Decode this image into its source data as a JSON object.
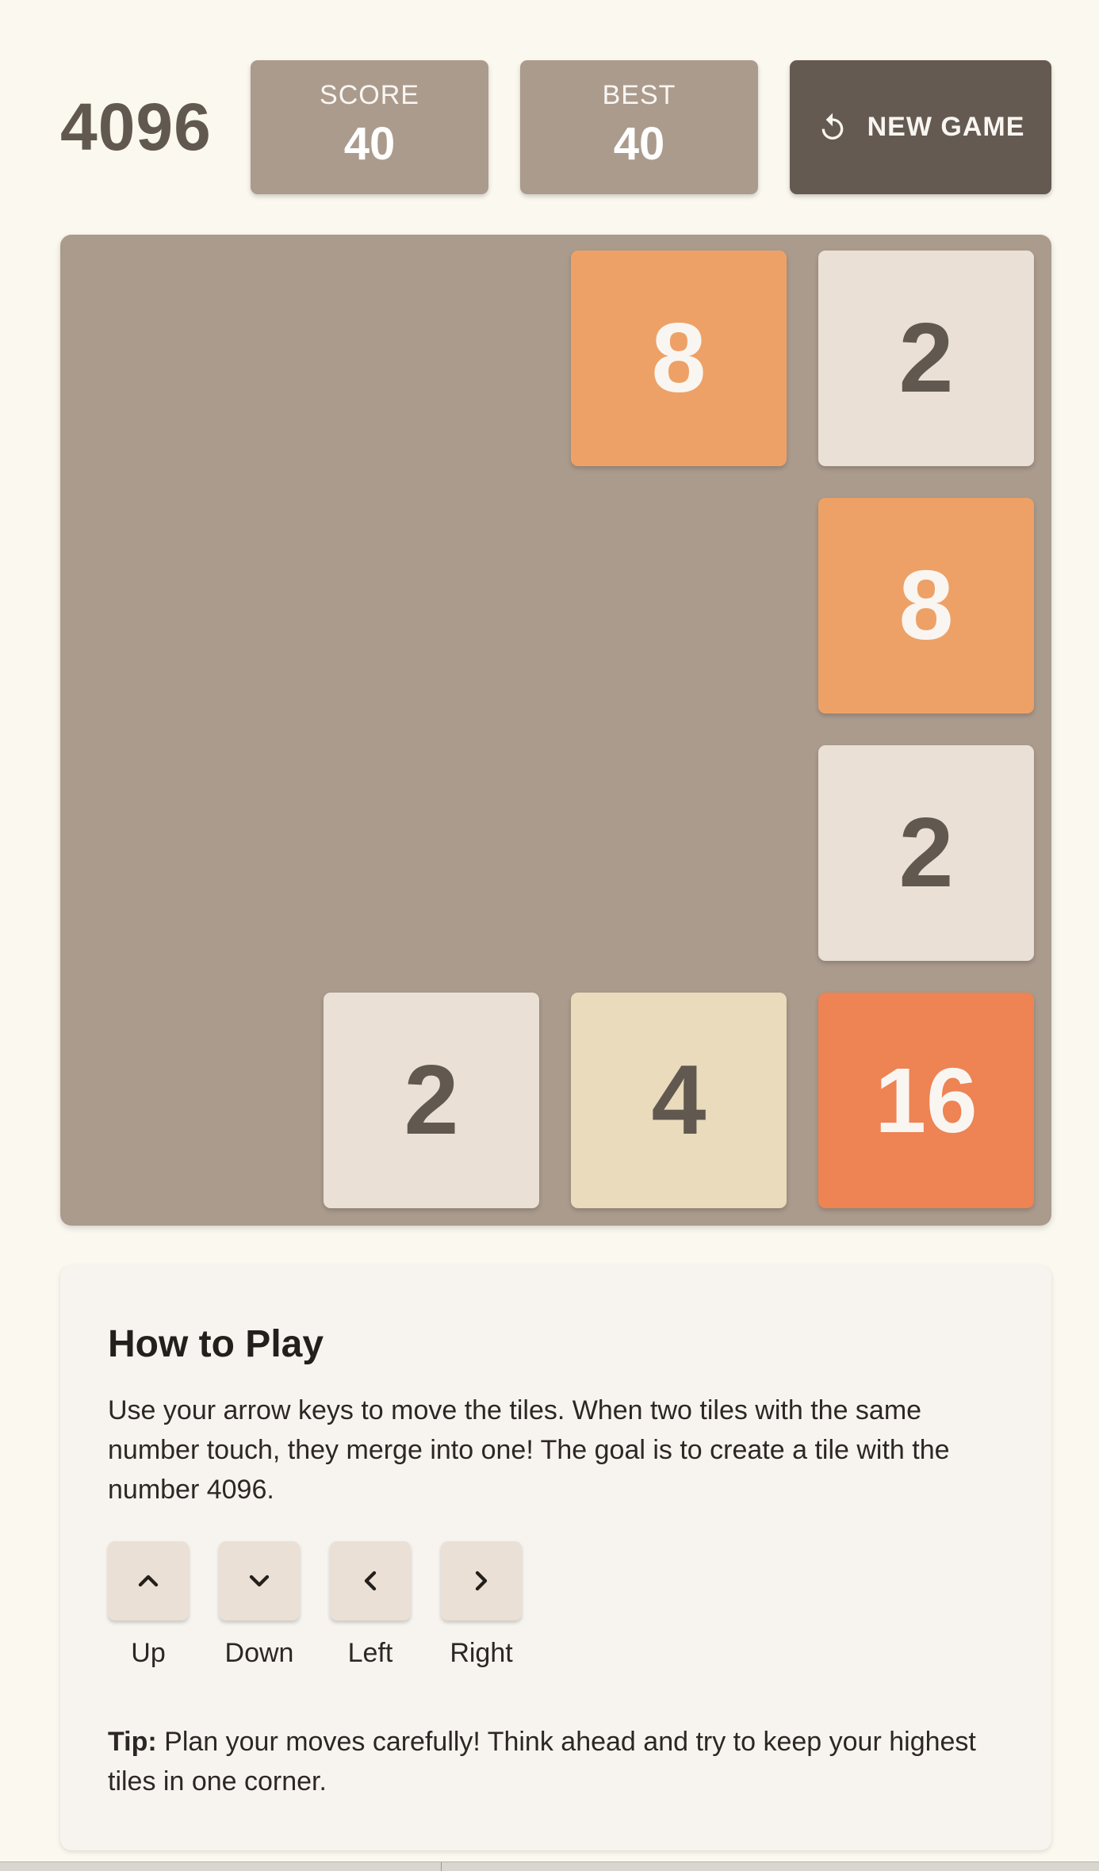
{
  "header": {
    "title": "4096",
    "score_label": "SCORE",
    "score_value": "40",
    "best_label": "BEST",
    "best_value": "40",
    "new_game_label": "NEW GAME",
    "new_game_icon": "refresh-icon"
  },
  "board": {
    "grid_size": 4,
    "tiles": [
      {
        "row": 0,
        "col": 2,
        "value": "8"
      },
      {
        "row": 0,
        "col": 3,
        "value": "2"
      },
      {
        "row": 1,
        "col": 3,
        "value": "8"
      },
      {
        "row": 2,
        "col": 3,
        "value": "2"
      },
      {
        "row": 3,
        "col": 1,
        "value": "2"
      },
      {
        "row": 3,
        "col": 2,
        "value": "4"
      },
      {
        "row": 3,
        "col": 3,
        "value": "16"
      }
    ]
  },
  "how_to_play": {
    "title": "How to Play",
    "description": "Use your arrow keys to move the tiles. When two tiles with the same number touch, they merge into one! The goal is to create a tile with the number 4096.",
    "controls": [
      {
        "label": "Up",
        "icon": "chevron-up-icon"
      },
      {
        "label": "Down",
        "icon": "chevron-down-icon"
      },
      {
        "label": "Left",
        "icon": "chevron-left-icon"
      },
      {
        "label": "Right",
        "icon": "chevron-right-icon"
      }
    ],
    "tip_label": "Tip:",
    "tip_text": " Plan your moves carefully! Think ahead and try to keep your highest tiles in one corner."
  },
  "colors": {
    "background": "#faf8ef",
    "board": "#ab9b8d",
    "tile_2": "#eae0d5",
    "tile_4": "#e9dbbb",
    "tile_8": "#eea166",
    "tile_16": "#ee8353",
    "new_game_button": "#645a51"
  }
}
